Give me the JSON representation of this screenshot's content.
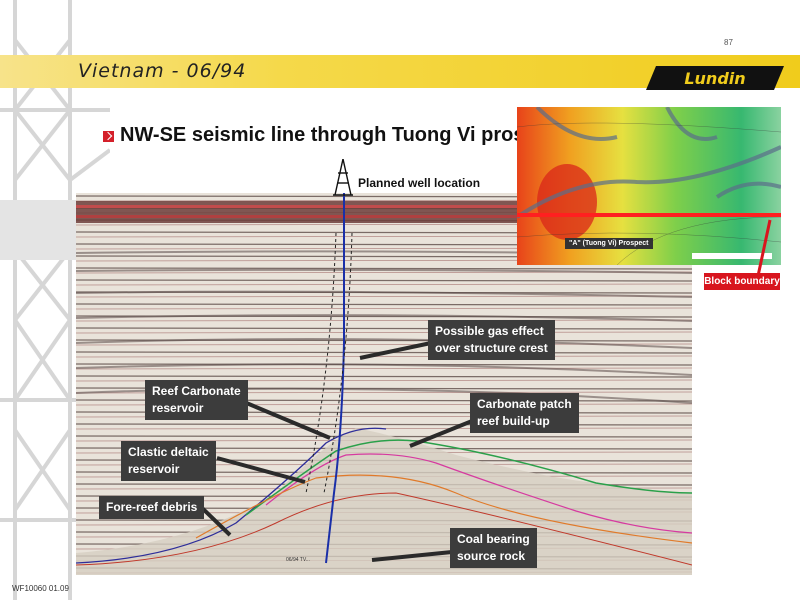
{
  "page_number": "87",
  "header": {
    "title": "Vietnam - 06/94",
    "logo_text": "Lundin"
  },
  "slide": {
    "title": "NW-SE seismic line through Tuong Vi prospect"
  },
  "seismic": {
    "well_label": "Planned well location",
    "line_label": "06/94 TV..."
  },
  "map": {
    "prospect_label": "\"A\" (Tuong Vi) Prospect",
    "block_label": "Block boundary"
  },
  "callouts": {
    "gas": [
      "Possible gas effect",
      "over structure crest"
    ],
    "reef_carbonate": [
      "Reef Carbonate",
      "reservoir"
    ],
    "carbonate_patch": [
      "Carbonate patch",
      "reef build-up"
    ],
    "clastic": [
      "Clastic deltaic",
      "reservoir"
    ],
    "fore_reef": "Fore-reef debris",
    "coal": [
      "Coal bearing",
      "source rock"
    ]
  },
  "footer": {
    "code": "WF10060  01.09"
  },
  "colors": {
    "header_yellow": "#f0cc1c",
    "accent_red": "#d8151e",
    "callout_gray": "#3c3c3c",
    "well_blue": "#1a2fa8"
  }
}
